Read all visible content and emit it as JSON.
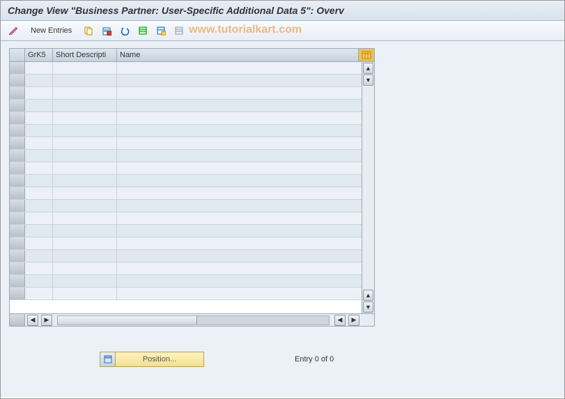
{
  "title": "Change View \"Business Partner: User-Specific Additional Data 5\": Overv",
  "watermark": "www.tutorialkart.com",
  "toolbar": {
    "new_entries_label": "New Entries"
  },
  "grid": {
    "columns": {
      "grk5": "GrK5",
      "short": "Short Descripti",
      "name": "Name"
    },
    "rows": [
      {
        "grk5": "",
        "short": "",
        "name": ""
      },
      {
        "grk5": "",
        "short": "",
        "name": ""
      },
      {
        "grk5": "",
        "short": "",
        "name": ""
      },
      {
        "grk5": "",
        "short": "",
        "name": ""
      },
      {
        "grk5": "",
        "short": "",
        "name": ""
      },
      {
        "grk5": "",
        "short": "",
        "name": ""
      },
      {
        "grk5": "",
        "short": "",
        "name": ""
      },
      {
        "grk5": "",
        "short": "",
        "name": ""
      },
      {
        "grk5": "",
        "short": "",
        "name": ""
      },
      {
        "grk5": "",
        "short": "",
        "name": ""
      },
      {
        "grk5": "",
        "short": "",
        "name": ""
      },
      {
        "grk5": "",
        "short": "",
        "name": ""
      },
      {
        "grk5": "",
        "short": "",
        "name": ""
      },
      {
        "grk5": "",
        "short": "",
        "name": ""
      },
      {
        "grk5": "",
        "short": "",
        "name": ""
      },
      {
        "grk5": "",
        "short": "",
        "name": ""
      },
      {
        "grk5": "",
        "short": "",
        "name": ""
      },
      {
        "grk5": "",
        "short": "",
        "name": ""
      },
      {
        "grk5": "",
        "short": "",
        "name": ""
      }
    ]
  },
  "footer": {
    "position_label": "Position...",
    "entry_text": "Entry 0 of 0"
  }
}
